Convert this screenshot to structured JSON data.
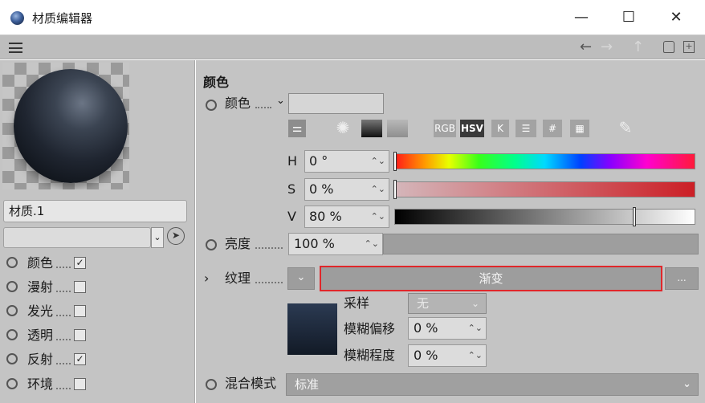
{
  "window": {
    "title": "材质编辑器",
    "minimize": "—",
    "maximize": "☐",
    "close": "✕"
  },
  "toolbar": {
    "back": "←",
    "forward": "→",
    "up": "↑",
    "lock": "🔓",
    "new": "+"
  },
  "left": {
    "material_name": "材质.1",
    "channels": [
      {
        "label": "颜色",
        "checked": true,
        "check": "✓"
      },
      {
        "label": "漫射",
        "checked": false,
        "check": ""
      },
      {
        "label": "发光",
        "checked": false,
        "check": ""
      },
      {
        "label": "透明",
        "checked": false,
        "check": ""
      },
      {
        "label": "反射",
        "checked": true,
        "check": "✓"
      },
      {
        "label": "环境",
        "checked": false,
        "check": ""
      }
    ]
  },
  "main": {
    "section_title": "颜色",
    "color_label": "颜色",
    "color_dropdown_arrow": "⌄",
    "modes": {
      "rgb": "RGB",
      "hsv": "HSV",
      "k": "K",
      "hash": "#"
    },
    "h": {
      "label": "H",
      "value": "0 °"
    },
    "s": {
      "label": "S",
      "value": "0 %"
    },
    "v": {
      "label": "V",
      "value": "80 %",
      "level": 0.8
    },
    "brightness": {
      "label": "亮度",
      "value": "100 %"
    },
    "texture": {
      "expander": "›",
      "label": "纹理",
      "dropdown_arrow": "⌄",
      "shader": "渐变",
      "more": "...",
      "sampling_label": "采样",
      "sampling_value": "无",
      "blur_offset_label": "模糊偏移",
      "blur_offset_value": "0 %",
      "blur_scale_label": "模糊程度",
      "blur_scale_value": "0 %"
    },
    "blend": {
      "label": "混合模式",
      "value": "标准",
      "arrow": "⌄"
    }
  },
  "colors": {
    "highlight": "#e0262a",
    "panel": "#c4c4c4"
  }
}
